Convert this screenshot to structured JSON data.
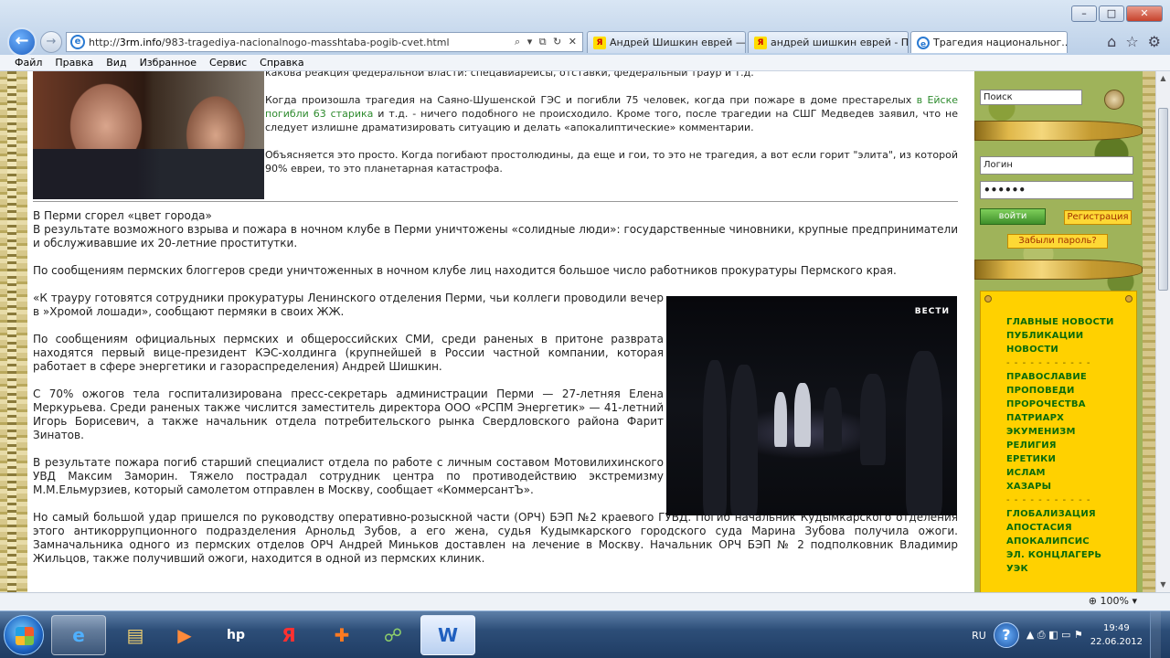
{
  "browser": {
    "window_buttons": {
      "minimize": "–",
      "maximize": "□",
      "close": "✕"
    },
    "url_prefix": "http://",
    "url_host": "3rm.info",
    "url_path": "/983-tragediya-nacionalnogo-masshtaba-pogib-cvet.html",
    "addr_tools": "⌕ ▾ ⧉ ↻ ✕",
    "tabs": [
      {
        "label": "Андрей Шишкин еврей — ...",
        "icon": "yandex-icon",
        "active": false
      },
      {
        "label": "андрей шишкин еврей - П...",
        "icon": "yandex-icon",
        "active": false
      },
      {
        "label": "Трагедия национальног...",
        "icon": "ie-icon",
        "active": true
      }
    ],
    "tab_close": "✕",
    "toolbar_icons": [
      "home-icon",
      "star-icon",
      "gear-icon"
    ],
    "menu": [
      "Файл",
      "Правка",
      "Вид",
      "Избранное",
      "Сервис",
      "Справка"
    ],
    "zoom": "100%"
  },
  "article": {
    "cut_line": "какова реакция федеральной власти: спецавиарейсы, отставки, федеральный траур и т.д.",
    "top_para_1_a": "Когда произошла трагедия на Саяно-Шушенской ГЭС и погибли 75 человек, когда при пожаре в доме престарелых ",
    "top_para_1_link": "в Ейске погибли 63 старика",
    "top_para_1_b": " и т.д. - ничего подобного не происходило. Кроме того, после трагедии на СШГ Медведев заявил, что не следует излишне драматизировать ситуацию и делать «апокалиптические» комментарии.",
    "top_para_2": "Объясняется это просто. Когда погибают простолюдины, да еще и гои, то это не трагедия, а вот если горит \"элита\", из которой 90% евреи, то это планетарная катастрофа.",
    "heading": "В Перми сгорел «цвет города»",
    "p1": "В результате возможного взрыва и пожара в ночном клубе в Перми уничтожены «солидные люди»: государственные чиновники, крупные предприниматели и обслуживавшие их 20-летние проститутки.",
    "p2": "По сообщениям пермских блоггеров среди уничтоженных в ночном клубе лиц находится большое число работников прокуратуры Пермского края.",
    "p3": "«К трауру готовятся сотрудники прокуратуры Ленинского отделения Перми, чьи коллеги проводили вечер в »Хромой лошади», сообщают пермяки в своих ЖЖ.",
    "p4": "По сообщениям официальных пермских и общероссийских СМИ, среди раненых в притоне разврата находятся первый вице-президент КЭС-холдинга (крупнейшей в России частной компании, которая работает в сфере энергетики и газораспределения) Андрей Шишкин.",
    "p5": "С 70% ожогов тела госпитализирована пресс-секретарь администрации Перми — 27-летняя Елена Меркурьева. Среди раненых также числится заместитель директора ООО «РСПМ Энергетик» — 41-летний Игорь Борисевич, а также начальник отдела потребительского рынка Свердловского района Фарит Зинатов.",
    "p6": "В результате пожара погиб старший специалист отдела по работе с личным составом Мотовилихинского УВД Максим Заморин. Тяжело пострадал сотрудник центра по противодействию экстремизму М.М.Ельмурзиев, который самолетом отправлен в Москву, сообщает «КоммерсантЪ».",
    "p7": "Но самый большой удар пришелся по руководству оперативно-розыскной части (ОРЧ) БЭП №2 краевого ГУВД. Погиб начальник Кудымкарского отделения этого антикоррупционного подразделения Арнольд Зубов, а его жена, судья Кудымкарского городского суда Марина Зубова получила ожоги. Замначальника одного из пермских отделов ОРЧ Андрей Миньков доставлен на лечение в Москву. Начальник ОРЧ БЭП № 2 подполковник Владимир Жильцов, также получивший ожоги, находится в одной из пермских клиник.",
    "video_logo": "ВЕСТИ"
  },
  "sidebar": {
    "search_placeholder": "Поиск",
    "login_placeholder": "Логин",
    "password_mask": "••••••",
    "enter_label": "войти",
    "register_label": "Регистрация",
    "forgot_label": "Забыли пароль?",
    "nav_sep": "- - - - - - - - - - -",
    "nav_group_1": [
      "ГЛАВНЫЕ НОВОСТИ",
      "ПУБЛИКАЦИИ",
      "НОВОСТИ"
    ],
    "nav_group_2": [
      "ПРАВОСЛАВИЕ",
      "ПРОПОВЕДИ",
      "ПРОРОЧЕСТВА",
      "ПАТРИАРХ",
      "ЭКУМЕНИЗМ",
      "РЕЛИГИЯ",
      "ЕРЕТИКИ",
      "ИСЛАМ",
      "ХАЗАРЫ"
    ],
    "nav_group_3": [
      "ГЛОБАЛИЗАЦИЯ",
      "АПОСТАСИЯ",
      "АПОКАЛИПСИС",
      "ЭЛ. КОНЦЛАГЕРЬ",
      "УЭК"
    ]
  },
  "taskbar": {
    "lang": "RU",
    "time": "19:49",
    "date": "22.06.2012",
    "apps": [
      {
        "name": "ie-taskbar",
        "glyph": "e",
        "active": true
      },
      {
        "name": "explorer-taskbar",
        "glyph": "▤",
        "active": false
      },
      {
        "name": "media-player-taskbar",
        "glyph": "▶",
        "active": false
      },
      {
        "name": "hp-taskbar",
        "glyph": "hp",
        "active": false
      },
      {
        "name": "yandex-taskbar",
        "glyph": "Я",
        "active": false
      },
      {
        "name": "office-taskbar",
        "glyph": "✚",
        "active": false
      },
      {
        "name": "network-taskbar",
        "glyph": "☍",
        "active": false
      },
      {
        "name": "word-taskbar",
        "glyph": "W",
        "active": false
      }
    ],
    "help": "?",
    "tray_icons": "▲ ⎙ ◧ ▭ ⚑"
  },
  "colors": {
    "link_green": "#2e8b2e",
    "nav_green": "#0a6b0a",
    "nav_bg": "#ffd100"
  }
}
